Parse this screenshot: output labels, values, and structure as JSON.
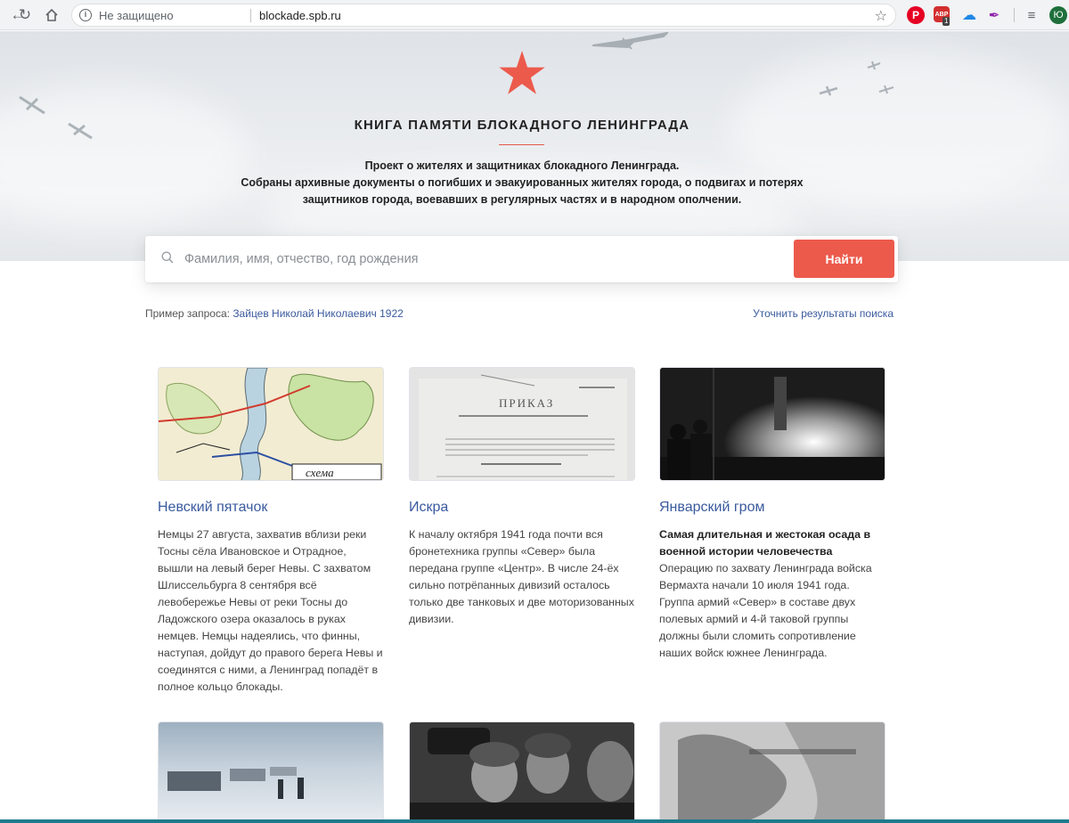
{
  "browser": {
    "insecure_label": "Не защищено",
    "url": "blockade.spb.ru",
    "adblock_label": "ABP",
    "adblock_badge": "1",
    "profile_initial": "Ю"
  },
  "hero": {
    "title": "КНИГА ПАМЯТИ БЛОКАДНОГО ЛЕНИНГРАДА",
    "desc_line1": "Проект о жителях и защитниках блокадного Ленинграда.",
    "desc_line2": "Собраны архивные документы о погибших и эвакуированных жителях города, о подвигах и потерях",
    "desc_line3": "защитников города, воевавших в регулярных частях и в народном ополчении.",
    "star_color": "#ec5a4c"
  },
  "search": {
    "placeholder": "Фамилия, имя, отчество, год рождения",
    "button_label": "Найти",
    "example_prefix": "Пример запроса:",
    "example_link": "Зайцев Николай Николаевич 1922",
    "refine_label": "Уточнить результаты поиска"
  },
  "cards": [
    {
      "title": "Невский пятачок",
      "lead": "",
      "text": "Немцы 27 августа, захватив вблизи реки Тосны сёла Ивановское и Отрадное, вышли на левый берег Невы. С захватом Шлиссельбурга 8 сентября всё левобережье Невы от реки Тосны до Ладожского озера оказалось в руках немцев. Немцы надеялись, что финны, наступая, дойдут до правого берега Невы и соединятся с ними, а Ленинград попадёт в полное кольцо блокады.",
      "image_caption": "схема"
    },
    {
      "title": "Искра",
      "lead": "",
      "text": "К началу октября 1941 года почти вся бронетехника группы «Север» была передана группе «Центр». В числе 24-ёх сильно потрёпанных дивизий осталось только две танковых и две моторизованных дивизии.",
      "image_caption": "ПРИКАЗ"
    },
    {
      "title": "Январский гром",
      "lead": "Самая длительная и жестокая осада в военной истории человечества",
      "text": "Операцию по захвату Ленинграда войска Вермахта начали 10 июля 1941 года. Группа армий «Север» в составе двух полевых армий и 4-й таковой группы должны были сломить сопротивление наших войск южнее Ленинграда.",
      "image_caption": ""
    }
  ],
  "colors": {
    "accent": "#ec5a4c",
    "link": "#3a5a9e"
  }
}
